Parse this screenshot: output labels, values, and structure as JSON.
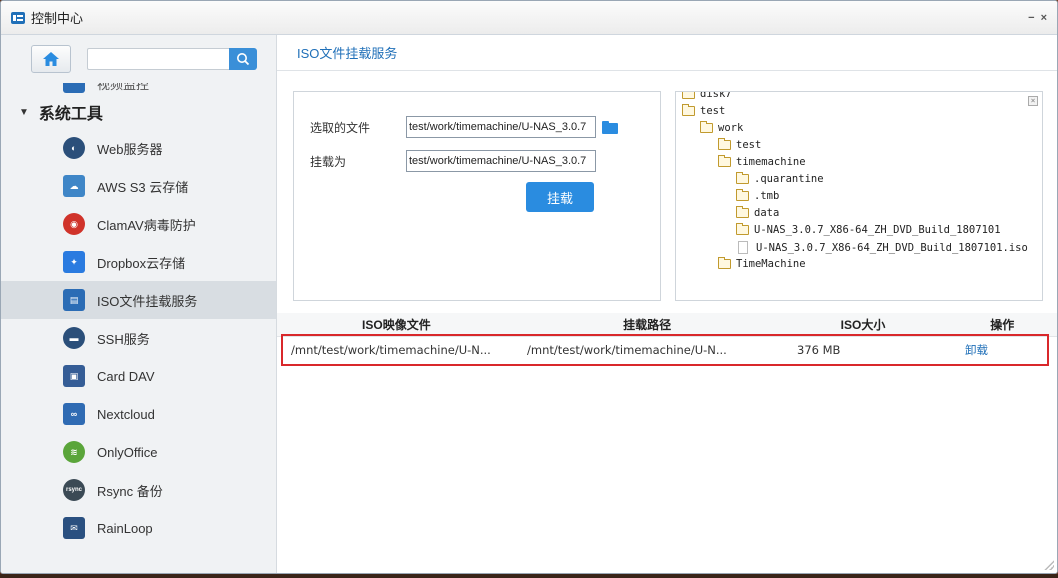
{
  "window": {
    "title": "控制中心",
    "minimize": "−",
    "close": "×"
  },
  "sidebar": {
    "search_placeholder": "",
    "partial_item": {
      "label": "视频监控",
      "icon": "camera-icon"
    },
    "group": {
      "label": "系统工具",
      "collapse_glyph": "▼"
    },
    "items": [
      {
        "label": "Web服务器",
        "icon": "web-server-icon",
        "color": "#2b4f7a"
      },
      {
        "label": "AWS S3 云存储",
        "icon": "aws-s3-icon",
        "color": "#3f86c7"
      },
      {
        "label": "ClamAV病毒防护",
        "icon": "antivirus-shield-icon",
        "color": "#d0332a"
      },
      {
        "label": "Dropbox云存储",
        "icon": "dropbox-icon",
        "color": "#2a7be0"
      },
      {
        "label": "ISO文件挂载服务",
        "icon": "iso-mount-icon",
        "color": "#2b6cb5",
        "active": true
      },
      {
        "label": "SSH服务",
        "icon": "ssh-icon",
        "color": "#2b4f7a"
      },
      {
        "label": "Card DAV",
        "icon": "carddav-icon",
        "color": "#355d96"
      },
      {
        "label": "Nextcloud",
        "icon": "nextcloud-icon",
        "color": "#2f6bb3"
      },
      {
        "label": "OnlyOffice",
        "icon": "onlyoffice-icon",
        "color": "#5aa53a"
      },
      {
        "label": "Rsync 备份",
        "icon": "rsync-icon",
        "color": "#3b4a55",
        "badge": "rsync"
      },
      {
        "label": "RainLoop",
        "icon": "rainloop-icon",
        "color": "#2a5080"
      }
    ]
  },
  "main": {
    "title": "ISO文件挂载服务",
    "form": {
      "selected_file_label": "选取的文件",
      "selected_file_value": "test/work/timemachine/U-NAS_3.0.7",
      "mount_as_label": "挂载为",
      "mount_as_value": "test/work/timemachine/U-NAS_3.0.7",
      "mount_button": "挂载"
    },
    "tree": {
      "close": "×",
      "nodes": [
        {
          "label": "disk7",
          "type": "folder"
        },
        {
          "label": "test",
          "type": "folder"
        },
        {
          "label": "work",
          "type": "folder"
        },
        {
          "label": "test",
          "type": "folder"
        },
        {
          "label": "timemachine",
          "type": "folder"
        },
        {
          "label": ".quarantine",
          "type": "folder"
        },
        {
          "label": ".tmb",
          "type": "folder"
        },
        {
          "label": "data",
          "type": "folder"
        },
        {
          "label": "U-NAS_3.0.7_X86-64_ZH_DVD_Build_1807101",
          "type": "folder"
        },
        {
          "label": "U-NAS_3.0.7_X86-64_ZH_DVD_Build_1807101.iso",
          "type": "file"
        },
        {
          "label": "TimeMachine",
          "type": "folder"
        }
      ]
    },
    "table": {
      "headers": [
        "ISO映像文件",
        "挂载路径",
        "ISO大小",
        "操作"
      ],
      "rows": [
        {
          "iso_file": "/mnt/test/work/timemachine/U-N...",
          "mount_path": "/mnt/test/work/timemachine/U-N...",
          "size": "376 MB",
          "action": "卸载"
        }
      ]
    }
  }
}
